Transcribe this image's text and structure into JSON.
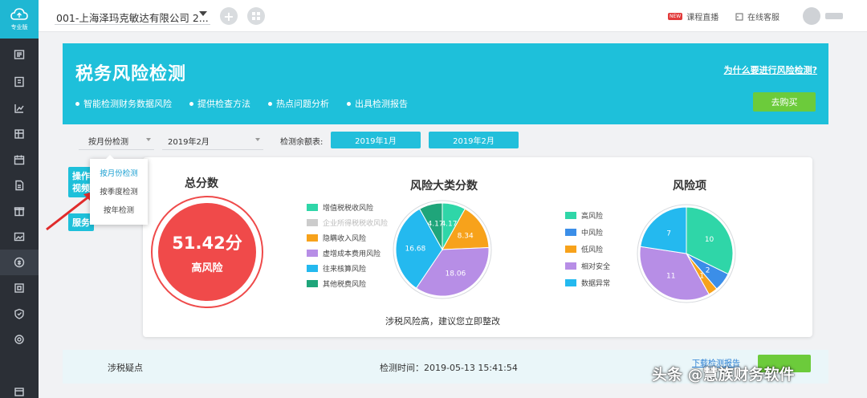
{
  "sidebar": {
    "logo_label": "专业版",
    "icons": [
      "voucher-icon",
      "ledger-icon",
      "report-chart-icon",
      "invoice-icon",
      "calendar-icon",
      "document-icon",
      "gift-icon",
      "picture-icon",
      "tax-risk-icon",
      "archive-icon",
      "shield-icon",
      "settings-icon",
      "calendar-small-icon"
    ]
  },
  "topbar": {
    "company": "001-上海泽玛克敏达有限公司 2...",
    "live_course": "课程直播",
    "new_tag": "NEW",
    "online_service": "在线客服"
  },
  "banner": {
    "title": "税务风险检测",
    "features": [
      "智能检测财务数据风险",
      "提供检查方法",
      "热点问题分析",
      "出具检测报告"
    ],
    "why_link": "为什么要进行风险检测?",
    "buy_button": "去购买",
    "background_color": "#1ec0da"
  },
  "filters": {
    "mode_value": "按月份检测",
    "period_value": "2019年2月",
    "remaining_label": "检测余额表:",
    "month_buttons": [
      "2019年1月",
      "2019年2月"
    ],
    "dropdown_options": [
      "按月份检测",
      "按季度检测",
      "按年检测"
    ]
  },
  "side_tabs": {
    "operation_line1": "操作",
    "operation_line2": "视频",
    "service": "服务"
  },
  "total_score": {
    "title": "总分数",
    "value": "51.42分",
    "level": "高风险",
    "color": "#f04a4a"
  },
  "categories": {
    "title": "风险大类分数"
  },
  "risk_items": {
    "title": "风险项"
  },
  "advice": "涉税风险高，建议您立即整改",
  "bottom": {
    "label": "涉税疑点",
    "check_time": "检测时间：2019-05-13 15:41:54",
    "link": "下载检测报告"
  },
  "watermark": "头条 @慧族财务软件",
  "chart_data": [
    {
      "type": "pie",
      "title": "风险大类分数",
      "categories": [
        "增值税税收风险",
        "企业所得税税收风险",
        "隐瞒收入风险",
        "虚增成本费用风险",
        "往来核算风险",
        "其他税费风险"
      ],
      "values": [
        4.17,
        0,
        8.34,
        18.06,
        16.68,
        4.17
      ],
      "labels": [
        "4.17",
        "",
        "8.34",
        "18.06",
        "16.68",
        "4.17"
      ],
      "colors": [
        "#2fd6a8",
        "#cccccc",
        "#f7a21b",
        "#b78ee6",
        "#24b9ef",
        "#1fa57a"
      ],
      "legend_position": "left"
    },
    {
      "type": "pie",
      "title": "风险项",
      "categories": [
        "高风险",
        "中风险",
        "低风险",
        "相对安全",
        "数据异常"
      ],
      "values": [
        10,
        2,
        1,
        11,
        7
      ],
      "labels": [
        "10",
        "2",
        "1",
        "11",
        "7"
      ],
      "colors": [
        "#2fd6a8",
        "#3b8ee8",
        "#f7a21b",
        "#b78ee6",
        "#24b9ef"
      ],
      "legend_position": "left"
    }
  ]
}
